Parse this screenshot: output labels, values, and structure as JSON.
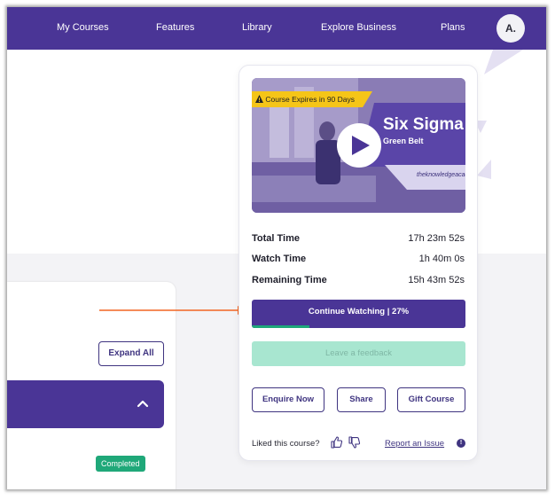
{
  "nav": {
    "items": [
      {
        "label": "My Courses"
      },
      {
        "label": "Features"
      },
      {
        "label": "Library"
      },
      {
        "label": "Explore Business"
      },
      {
        "label": "Plans"
      }
    ],
    "avatar_initial": "A."
  },
  "left_panel": {
    "expand_all_label": "Expand All",
    "section_chevron_icon": "chevron-up-icon",
    "completed_badge": "Completed"
  },
  "annotation": {
    "arrow_color": "#f26522",
    "arrow_icon": "arrow-right-icon"
  },
  "course_card": {
    "video": {
      "expires_text": "Course Expires in 90 Days",
      "warning_icon": "warning-icon",
      "title": "Six Sigma",
      "subtitle": "Green Belt",
      "brand": "theknowledgeacademy",
      "play_icon": "play-icon"
    },
    "stats": [
      {
        "label": "Total Time",
        "value": "17h 23m 52s"
      },
      {
        "label": "Watch Time",
        "value": "1h 40m 0s"
      },
      {
        "label": "Remaining Time",
        "value": "15h 43m 52s"
      }
    ],
    "continue_label": "Continue Watching | 27%",
    "progress_percent": 27,
    "feedback_label": "Leave a feedback",
    "enquire_label": "Enquire Now",
    "share_label": "Share",
    "gift_label": "Gift Course",
    "liked_label": "Liked this course?",
    "thumbs_up_icon": "thumbs-up-icon",
    "thumbs_down_icon": "thumbs-down-icon",
    "report_label": "Report an Issue",
    "info_icon": "info-icon"
  },
  "colors": {
    "brand_purple": "#4a3596",
    "success_green": "#1fa879",
    "warning_yellow": "#f5c518",
    "feedback_mint": "#a8e6d0"
  }
}
